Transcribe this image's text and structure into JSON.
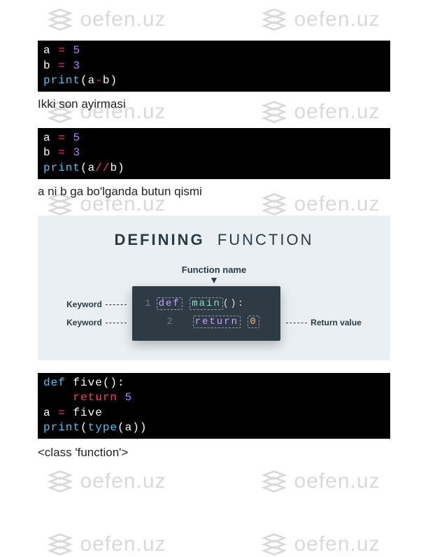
{
  "watermark_text": "oefen.uz",
  "code1": {
    "line1": {
      "var": "a",
      "op": "=",
      "num": "5"
    },
    "line2": {
      "var": "b",
      "op": "=",
      "num": "3"
    },
    "line3": {
      "fn": "print",
      "open": "(",
      "a": "a",
      "op": "-",
      "b": "b",
      "close": ")"
    }
  },
  "caption1": "Ikki son ayirmasi",
  "code2": {
    "line1": {
      "var": "a",
      "op": "=",
      "num": "5"
    },
    "line2": {
      "var": "b",
      "op": "=",
      "num": "3"
    },
    "line3": {
      "fn": "print",
      "open": "(",
      "a": "a",
      "op": "//",
      "b": "b",
      "close": ")"
    }
  },
  "caption2": "a ni b ga bo'lganda butun qismi",
  "diagram": {
    "title_bold": "DEFINING",
    "title_thin": "FUNCTION",
    "fn_name_label": "Function name",
    "keyword_label": "Keyword",
    "return_value_label": "Return value",
    "line1": {
      "num": "1",
      "kw": "def",
      "name": "main",
      "parens": "():"
    },
    "line2": {
      "num": "2",
      "kw": "return",
      "val": "0"
    }
  },
  "code3": {
    "line1": {
      "kw": "def",
      "name": "five",
      "parens": "():"
    },
    "line2": {
      "kw": "return",
      "num": "5"
    },
    "line3": {
      "var": "a",
      "op": "=",
      "val": "five"
    },
    "line4": {
      "fn": "print",
      "open": "(",
      "type": "type",
      "open2": "(",
      "a": "a",
      "close2": ")",
      "close": ")"
    }
  },
  "caption3": "<class 'function'>"
}
